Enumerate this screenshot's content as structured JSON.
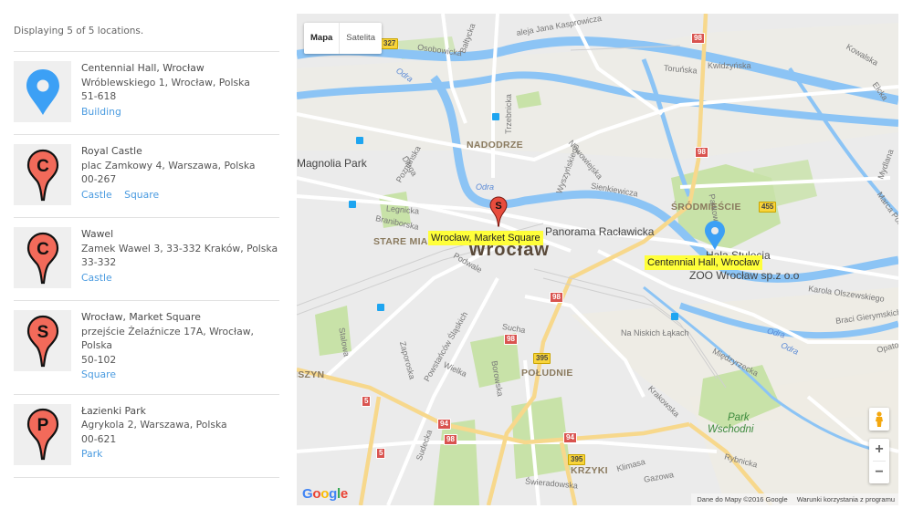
{
  "summary": "Displaying 5 of 5 locations.",
  "locations": [
    {
      "name": "Centennial Hall, Wrocław",
      "address": "Wróblewskiego 1, Wrocław, Polska",
      "address2": "",
      "postal": "51-618",
      "tags": [
        "Building"
      ],
      "icon": "blue-map-pin-icon",
      "letter": ""
    },
    {
      "name": "Royal Castle",
      "address": "plac Zamkowy 4, Warszawa, Polska",
      "address2": "",
      "postal": "00-267",
      "tags": [
        "Castle",
        "Square"
      ],
      "icon": "red-marker-c-icon",
      "letter": "C"
    },
    {
      "name": "Wawel",
      "address": "Zamek Wawel 3, 33-332 Kraków, Polska",
      "address2": "",
      "postal": "33-332",
      "tags": [
        "Castle"
      ],
      "icon": "red-marker-c-icon",
      "letter": "C"
    },
    {
      "name": "Wrocław, Market Square",
      "address": "przejście Żelaźnicze 17A, Wrocław,",
      "address2": "Polska",
      "postal": "50-102",
      "tags": [
        "Square"
      ],
      "icon": "red-marker-s-icon",
      "letter": "S"
    },
    {
      "name": "Łazienki Park",
      "address": "Agrykola 2, Warszawa, Polska",
      "address2": "",
      "postal": "00-621",
      "tags": [
        "Park"
      ],
      "icon": "red-marker-p-icon",
      "letter": "P"
    }
  ],
  "colors": {
    "accent_link": "#4a9be0",
    "pin_blue": "#3ca0f5",
    "pin_red": "#f26a5a",
    "info_label_bg": "#ffff3a",
    "water": "#8cc4f5",
    "park": "#c8e2a8",
    "road_major": "#f7d88c"
  },
  "map": {
    "type_control": {
      "map": "Mapa",
      "satellite": "Satelita"
    },
    "markers": [
      {
        "label": "Wrocław, Market Square",
        "letter": "S"
      },
      {
        "label": "Centennial Hall, Wrocław",
        "letter": ""
      }
    ],
    "labels": {
      "city": "Wrocław",
      "districts": {
        "nadodrze": "NADODRZE",
        "stare_miasto": "STARE MIAS",
        "srodmiescie": "ŚRÓDMIEŚCIE",
        "poludnie": "POŁUDNIE",
        "krzyki": "KRZYKI",
        "szyn": "ISZYN"
      },
      "pois": {
        "panorama": "Panorama Racławicka",
        "hala": "Hala Stulecia",
        "zoo": "ZOO Wrocław sp.z o.o",
        "magnolia": "Magnolia Park"
      },
      "parks": {
        "wschodni_1": "Park",
        "wschodni_2": "Wschodni"
      },
      "streets": {
        "kasprowicza": "aleja Jana Kasprowicza",
        "osobowicka": "Osobowicka",
        "baltycka": "Bałtycka",
        "trzebnicka": "Trzebnicka",
        "torunska": "Toruńska",
        "kwidzynska": "Kwidzyńska",
        "kowalska": "Kowalska",
        "elcka": "Ełcka",
        "poznanska": "Poznańska",
        "dluga": "Długa",
        "legnicka": "Legnicka",
        "braniborska": "Braniborska",
        "nowowiejska": "Nowowiejska",
        "sienkiewicza": "Sienkiewicza",
        "wyszynskiego": "Wyszyńskiego",
        "podwale": "Podwale",
        "mydlana": "Mydlana",
        "marca": "Marca Polo",
        "olszewskiego": "Karola Olszewskiego",
        "gierymskich": "Braci Gierymskich",
        "opatow": "Opatow",
        "niskich": "Na Niskich Łąkach",
        "miedzyrzecka": "Międzyrzecka",
        "krakowska": "Krakowska",
        "stalowa": "Stalowa",
        "zaporoska": "Zaporoska",
        "powstancow": "Powstańców Śląskich",
        "wielka": "Wielka",
        "borowska": "Borowska",
        "sucha": "Sucha",
        "sudecka": "Sudecka",
        "klimasa": "Klimasa",
        "gazowa": "Gazowa",
        "swieradowska": "Świeradowska",
        "rybnicka": "Rybnicka",
        "parkowa": "Parkowa"
      },
      "water": {
        "odra_1": "Odra",
        "odra_2": "Odra",
        "odra_3": "Odra",
        "odra_4": "Odra"
      }
    },
    "shields": {
      "s327": "327",
      "s98a": "98",
      "s98b": "98",
      "s98c": "98",
      "s98d": "98",
      "s98e": "98",
      "s455": "455",
      "s395a": "395",
      "s395b": "395",
      "s5a": "5",
      "s5b": "5",
      "s94a": "94",
      "s94b": "94"
    },
    "zoom_in": "+",
    "zoom_out": "−",
    "google_logo": [
      "G",
      "o",
      "o",
      "g",
      "l",
      "e"
    ],
    "attribution": "Dane do Mapy ©2016 Google",
    "terms": "Warunki korzystania z programu"
  }
}
